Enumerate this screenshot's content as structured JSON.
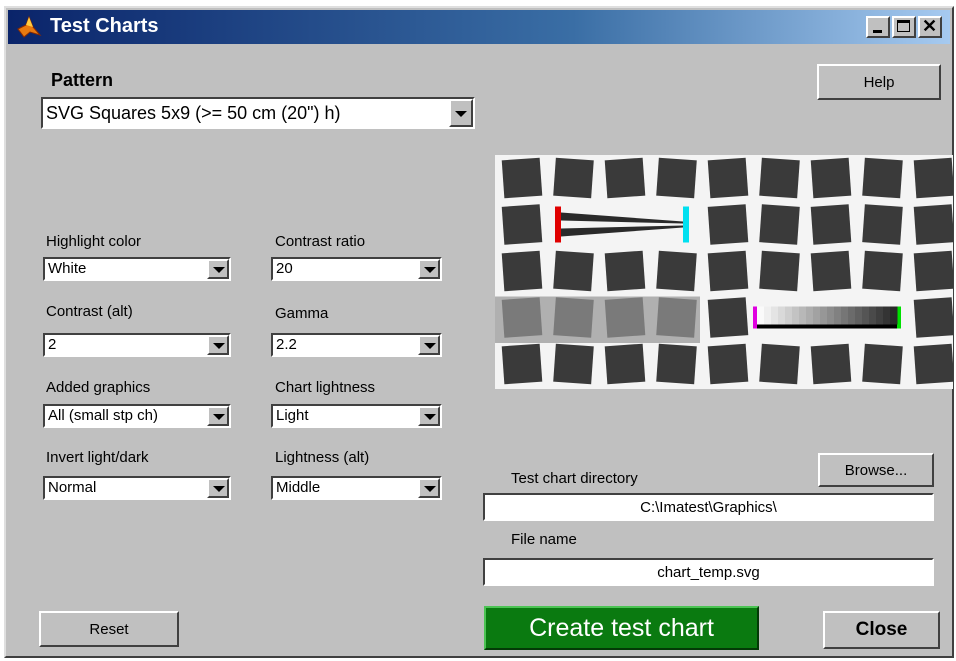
{
  "window": {
    "title": "Test Charts"
  },
  "pattern": {
    "label": "Pattern",
    "value": "SVG Squares 5x9 (>= 50 cm (20\") h)"
  },
  "options": {
    "highlight_color": {
      "label": "Highlight color",
      "value": "White"
    },
    "contrast_ratio": {
      "label": "Contrast ratio",
      "value": "20"
    },
    "contrast_alt": {
      "label": "Contrast (alt)",
      "value": "2"
    },
    "gamma": {
      "label": "Gamma",
      "value": "2.2"
    },
    "added_graphics": {
      "label": "Added graphics",
      "value": "All (small stp ch)"
    },
    "chart_lightness": {
      "label": "Chart lightness",
      "value": "Light"
    },
    "invert": {
      "label": "Invert light/dark",
      "value": "Normal"
    },
    "lightness_alt": {
      "label": "Lightness (alt)",
      "value": "Middle"
    }
  },
  "buttons": {
    "help": "Help",
    "browse": "Browse...",
    "reset": "Reset",
    "create": "Create test chart",
    "close": "Close"
  },
  "output": {
    "directory_label": "Test chart directory",
    "directory_value": "C:\\Imatest\\Graphics\\",
    "filename_label": "File name",
    "filename_value": "chart_temp.svg"
  },
  "preview": {
    "rows": 5,
    "cols": 9,
    "square_color": "#3a3a3a",
    "light_square_color": "#7a7a7a",
    "wedge_left_color": "#e00000",
    "wedge_right_color": "#00e0f0",
    "step_left_color": "#e000e0",
    "step_right_color": "#00e000"
  },
  "colors": {
    "face": "#c0c0c0",
    "create_button": "#0a7a10"
  }
}
